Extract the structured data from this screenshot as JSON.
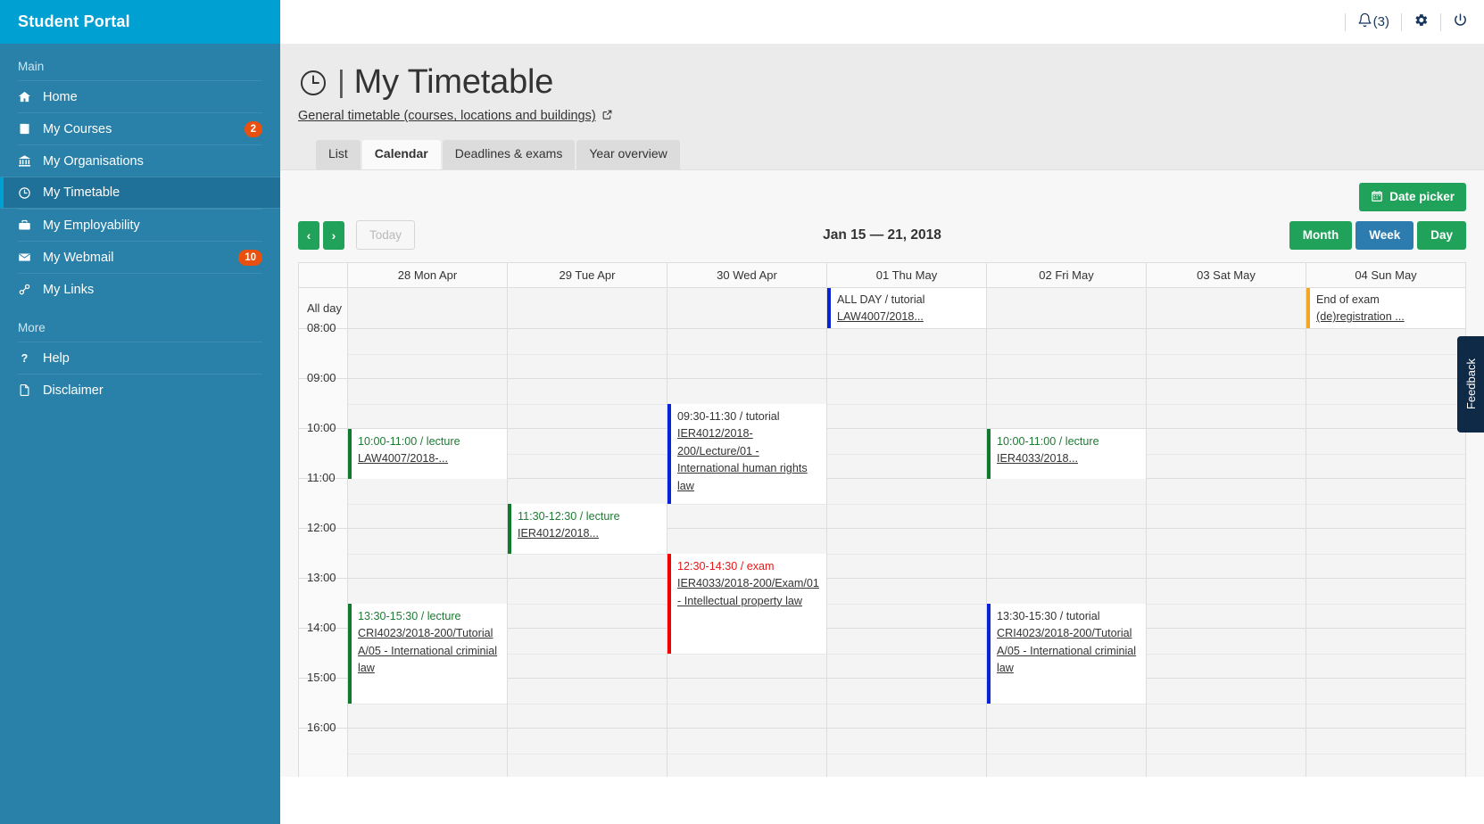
{
  "sidebar": {
    "brand": "Student Portal",
    "sections": [
      {
        "label": "Main",
        "items": [
          {
            "label": "Home",
            "icon": "home-icon",
            "badge": null,
            "active": false
          },
          {
            "label": "My Courses",
            "icon": "book-icon",
            "badge": "2",
            "active": false
          },
          {
            "label": "My Organisations",
            "icon": "bank-icon",
            "badge": null,
            "active": false
          },
          {
            "label": "My Timetable",
            "icon": "clock-icon",
            "badge": null,
            "active": true
          },
          {
            "label": "My Employability",
            "icon": "briefcase-icon",
            "badge": null,
            "active": false
          },
          {
            "label": "My Webmail",
            "icon": "envelope-icon",
            "badge": "10",
            "active": false
          },
          {
            "label": "My Links",
            "icon": "link-icon",
            "badge": null,
            "active": false
          }
        ]
      },
      {
        "label": "More",
        "items": [
          {
            "label": "Help",
            "icon": "question-icon",
            "badge": null,
            "active": false
          },
          {
            "label": "Disclaimer",
            "icon": "file-icon",
            "badge": null,
            "active": false
          }
        ]
      }
    ]
  },
  "topbar": {
    "notifications_count": "(3)",
    "notifications_icon": "bell-icon",
    "settings_icon": "gear-icon",
    "logout_icon": "power-icon"
  },
  "header": {
    "title": "My Timetable",
    "title_icon": "clock-icon",
    "separator": "|",
    "subtitle_link": "General timetable (courses, locations and buildings)",
    "subtitle_icon": "external-link-icon"
  },
  "tabs": [
    {
      "label": "List",
      "active": false
    },
    {
      "label": "Calendar",
      "active": true
    },
    {
      "label": "Deadlines & exams",
      "active": false
    },
    {
      "label": "Year overview",
      "active": false
    }
  ],
  "toolbar": {
    "date_picker_label": "Date picker",
    "date_picker_icon": "calendar-icon",
    "prev_label": "‹",
    "next_label": "›",
    "today_label": "Today",
    "period_label": "Jan 15 — 21, 2018",
    "views": [
      {
        "label": "Month",
        "active": false
      },
      {
        "label": "Week",
        "active": true
      },
      {
        "label": "Day",
        "active": false
      }
    ]
  },
  "calendar": {
    "allday_label": "All day",
    "days": [
      "28 Mon Apr",
      "29 Tue Apr",
      "30 Wed Apr",
      "01 Thu May",
      "02 Fri May",
      "03 Sat May",
      "04 Sun May"
    ],
    "hours": [
      "08:00",
      "09:00",
      "10:00",
      "11:00",
      "12:00",
      "13:00",
      "14:00",
      "15:00",
      "16:00"
    ],
    "allday_events": [
      {
        "day": 3,
        "color": "blue",
        "time": "ALL DAY / tutorial",
        "title": "LAW4007/2018..."
      },
      {
        "day": 6,
        "color": "orange",
        "time": "End of exam",
        "title": "(de)registration ..."
      }
    ],
    "events": [
      {
        "day": 0,
        "color": "green",
        "time": "10:00-11:00 / lecture",
        "title": "LAW4007/2018-...",
        "start": "10:00",
        "end": "11:00"
      },
      {
        "day": 2,
        "color": "blue",
        "time": "09:30-11:30 / tutorial",
        "title": "IER4012/2018-200/Lecture/01 - International human rights law",
        "start": "09:30",
        "end": "11:30"
      },
      {
        "day": 4,
        "color": "green",
        "time": "10:00-11:00 / lecture",
        "title": "IER4033/2018...",
        "start": "10:00",
        "end": "11:00"
      },
      {
        "day": 1,
        "color": "green",
        "time": "11:30-12:30 / lecture",
        "title": "IER4012/2018...",
        "start": "11:30",
        "end": "12:30"
      },
      {
        "day": 2,
        "color": "red",
        "time": "12:30-14:30 / exam",
        "title": "IER4033/2018-200/Exam/01 - Intellectual property law",
        "start": "12:30",
        "end": "14:30"
      },
      {
        "day": 0,
        "color": "green",
        "time": "13:30-15:30 / lecture",
        "title": "CRI4023/2018-200/Tutorial A/05 - International criminial law",
        "start": "13:30",
        "end": "15:30"
      },
      {
        "day": 4,
        "color": "blue",
        "time": "13:30-15:30 / tutorial",
        "title": "CRI4023/2018-200/Tutorial A/05 - International criminial law",
        "start": "13:30",
        "end": "15:30"
      }
    ]
  },
  "feedback": {
    "label": "Feedback"
  },
  "colors": {
    "brand": "#00a0d2",
    "sidebar": "#2980a8",
    "sidebar_active": "#20719a",
    "badge": "#e8500f",
    "green": "#21a25a",
    "blue": "#2c7cb0",
    "event_green": "#0d7a2e",
    "event_blue": "#0b23d6",
    "event_red": "#f00000",
    "event_orange": "#f5a623"
  }
}
